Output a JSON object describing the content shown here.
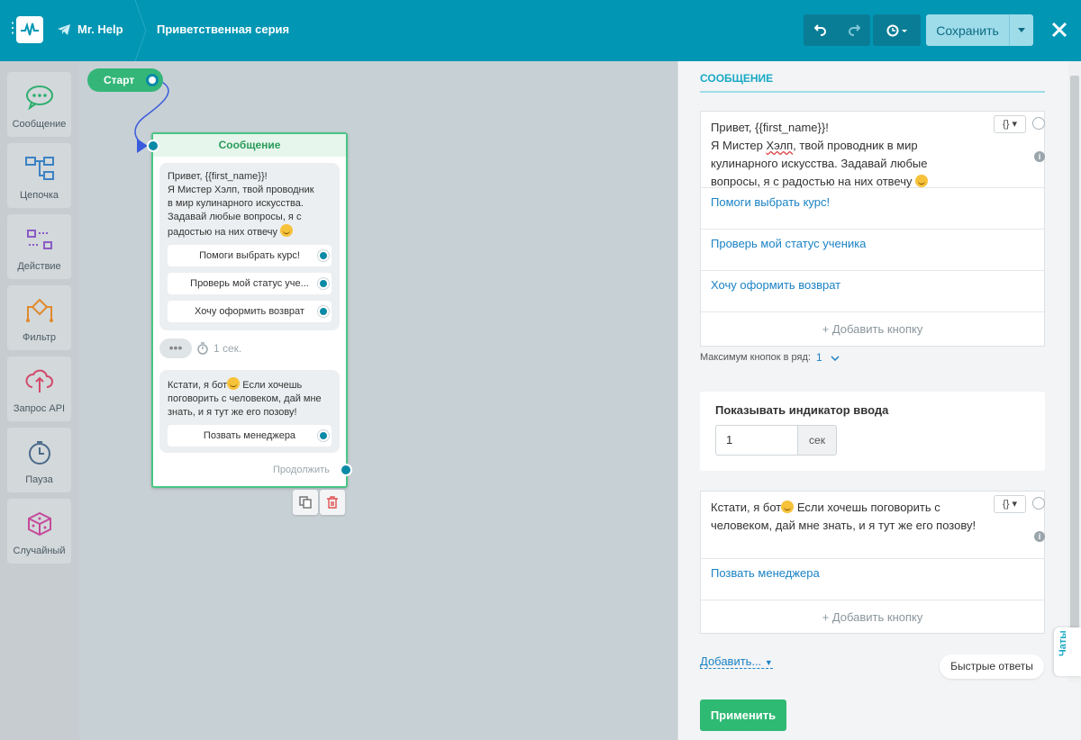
{
  "header": {
    "bot_name": "Mr. Help",
    "flow_name": "Приветственная серия",
    "save_label": "Сохранить"
  },
  "tools": [
    {
      "label": "Сообщение",
      "icon": "message-icon"
    },
    {
      "label": "Цепочка",
      "icon": "chain-icon"
    },
    {
      "label": "Действие",
      "icon": "action-icon"
    },
    {
      "label": "Фильтр",
      "icon": "filter-icon"
    },
    {
      "label": "Запрос API",
      "icon": "api-request-icon"
    },
    {
      "label": "Пауза",
      "icon": "pause-icon"
    },
    {
      "label": "Случайный",
      "icon": "random-icon"
    }
  ],
  "canvas": {
    "start_label": "Старт",
    "node_title": "Сообщение",
    "msg1": [
      "Привет, {{first_name}}!",
      "Я Мистер Хэлп, твой проводник",
      "в мир кулинарного искусства.",
      "Задавай любые вопросы, я с",
      "радостью на них отвечу"
    ],
    "msg1_buttons": [
      "Помоги выбрать курс!",
      "Проверь мой статус уче...",
      "Хочу оформить возврат"
    ],
    "pause": "1 сек.",
    "msg2": [
      "Кстати, я бот",
      " Если хочешь",
      "поговорить с человеком, дай мне",
      "знать, и я тут же его позову!"
    ],
    "msg2_buttons": [
      "Позвать менеджера"
    ],
    "continue": "Продолжить"
  },
  "panel": {
    "section_title": "СООБЩЕНИЕ",
    "text1_line1": "Привет, {{first_name}}!",
    "text1_line2a": "Я Мистер ",
    "text1_line2b": "Хэлп",
    "text1_line2c": ", твой проводник в мир",
    "text1_line3": "кулинарного искусства. Задавай любые",
    "text1_line4": "вопросы, я с радостью на них отвечу",
    "buttons1": [
      "Помоги выбрать курс!",
      "Проверь мой статус ученика",
      "Хочу оформить возврат"
    ],
    "add_button": "+ Добавить кнопку",
    "max_label": "Максимум кнопок в ряд:",
    "max_value": "1",
    "typing_title": "Показывать индикатор ввода",
    "typing_value": "1",
    "typing_unit": "сек",
    "text2_line1a": "Кстати, я бот",
    "text2_line1b": " Если хочешь поговорить с",
    "text2_line2": "человеком, дай мне знать, и я тут же его позову!",
    "buttons2": [
      "Позвать менеджера"
    ],
    "add_menu": "Добавить...",
    "quick_replies": "Быстрые ответы",
    "apply": "Применить",
    "chats_tab": "Чаты",
    "vars_label": "{}"
  },
  "colors": {
    "header": "#0096b4",
    "accent": "#1aa9c4",
    "green": "#2fba74",
    "link": "#1a82c4"
  }
}
